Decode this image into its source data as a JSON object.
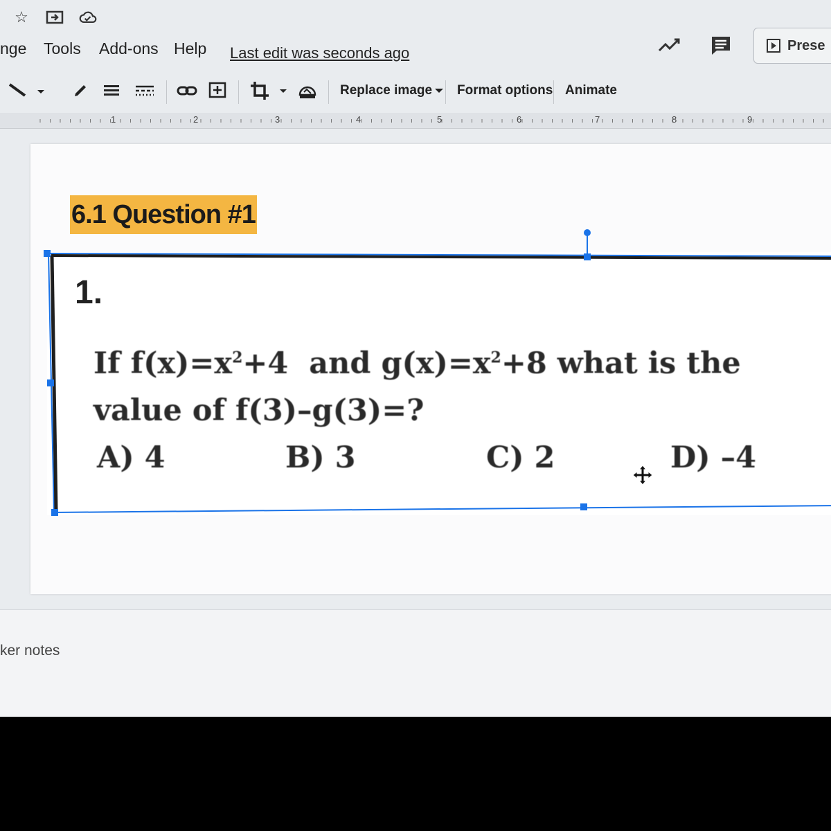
{
  "menu": {
    "items": [
      "nge",
      "Tools",
      "Add-ons",
      "Help"
    ],
    "last_edit": "Last edit was seconds ago"
  },
  "header": {
    "present_label": "Prese"
  },
  "toolbar": {
    "replace_image": "Replace image",
    "format_options": "Format options",
    "animate": "Animate"
  },
  "ruler": {
    "numbers": [
      "1",
      "2",
      "3",
      "4",
      "5",
      "6",
      "7",
      "8",
      "9"
    ]
  },
  "slide": {
    "title": "6.1 Question #1",
    "question_number": "1.",
    "line1_a": "If f(x)=x",
    "line1_sup1": "2",
    "line1_b": "+4  and g(x)=x",
    "line1_sup2": "2",
    "line1_c": "+8 what is the",
    "line2": "value of f(3)–g(3)=?",
    "choices": [
      "A) 4",
      "B) 3",
      "C) 2",
      "D) –4"
    ]
  },
  "notes": {
    "label": "ker notes"
  },
  "colors": {
    "title_highlight": "#f4b642",
    "selection": "#1a73e8"
  }
}
